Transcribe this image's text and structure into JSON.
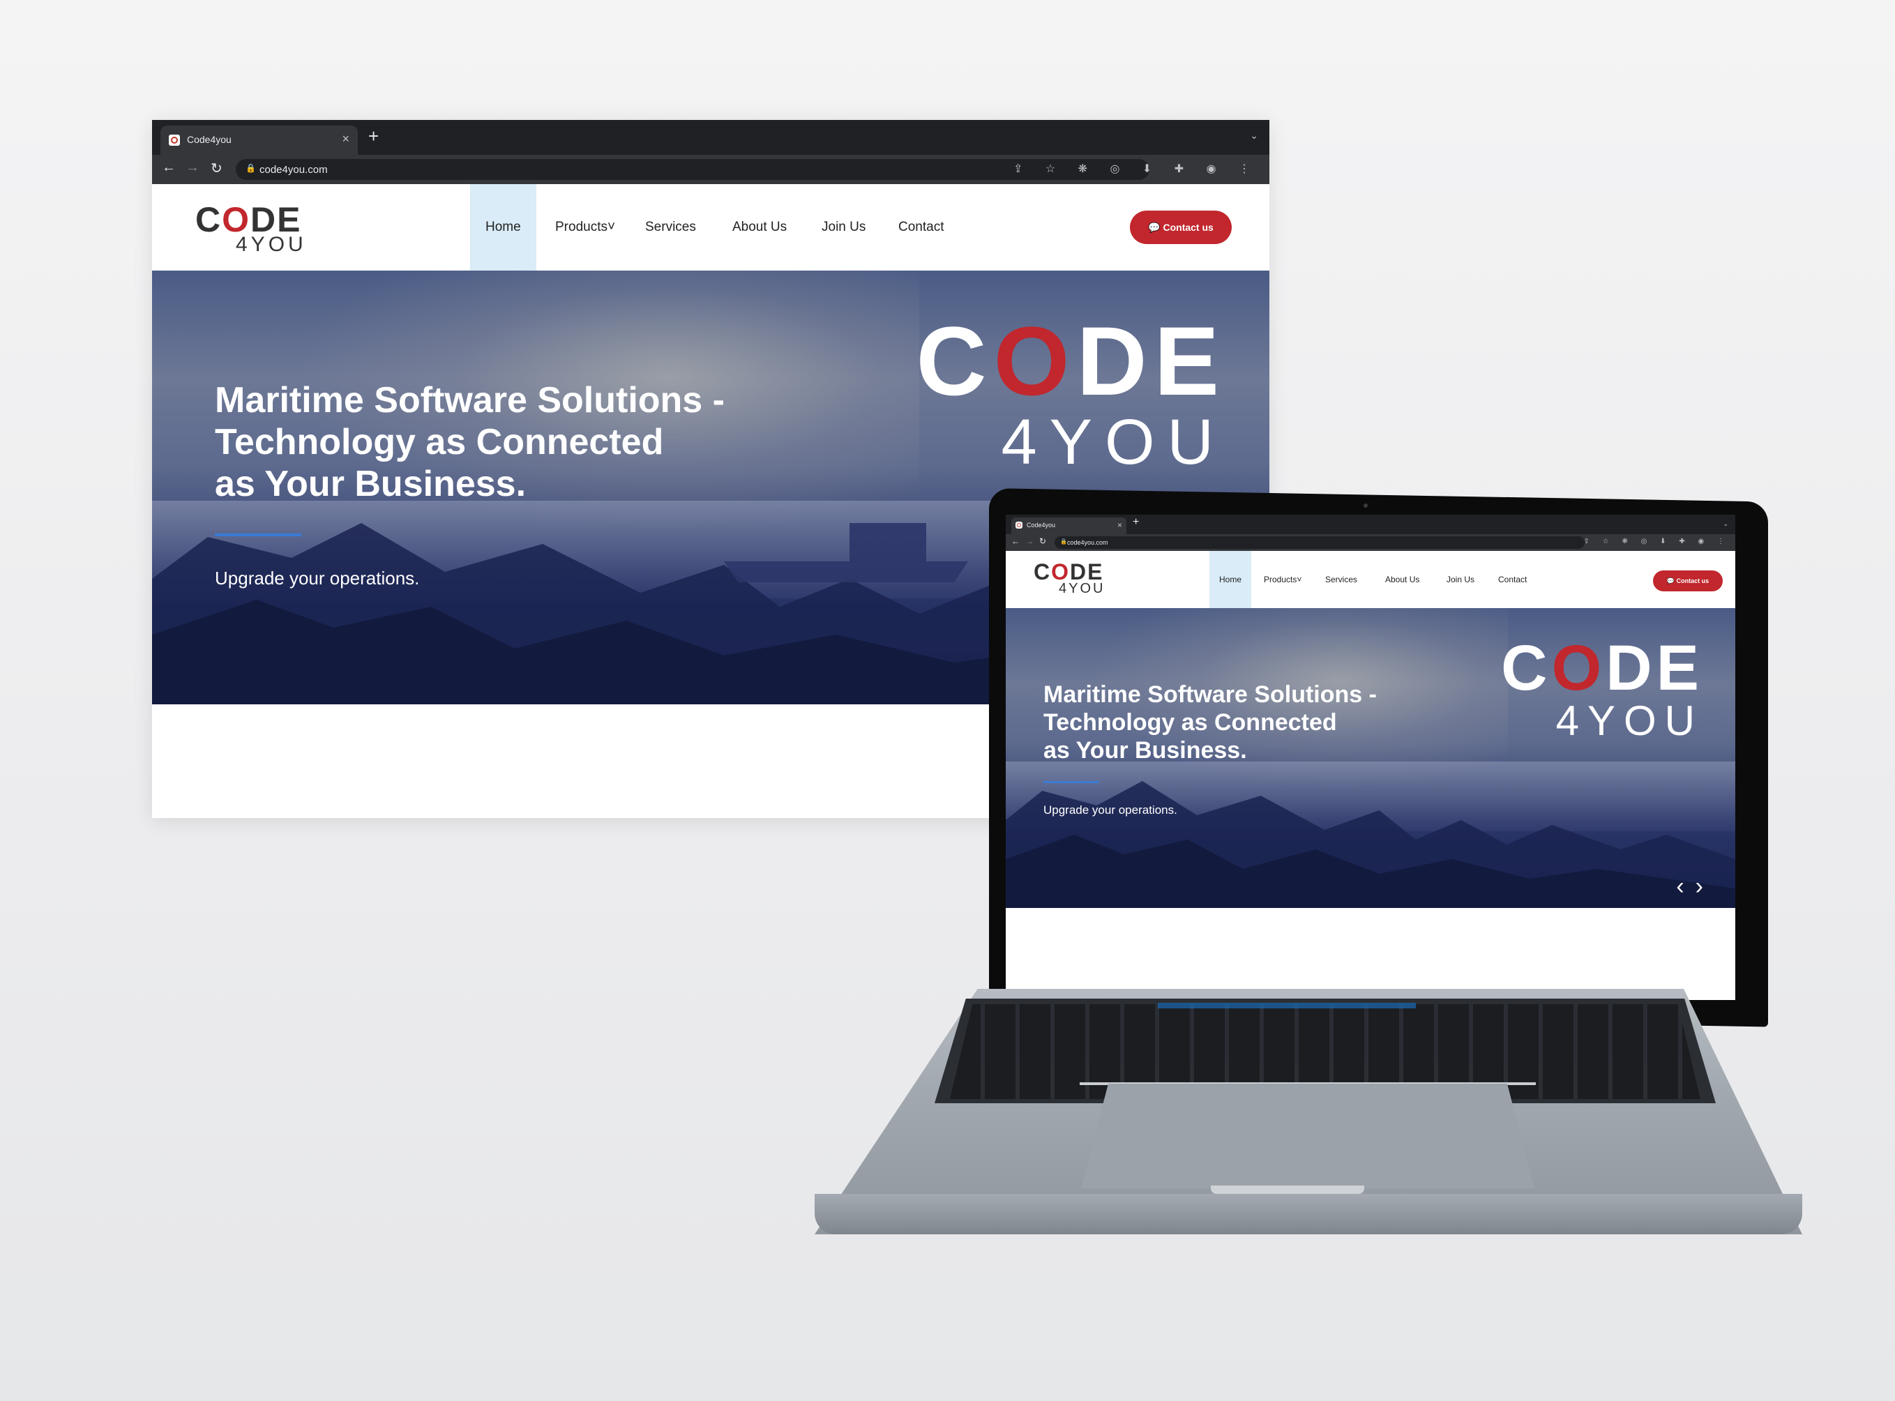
{
  "browser": {
    "tab_title": "Code4you",
    "url": "code4you.com",
    "new_tab": "+",
    "close": "×",
    "tab_menu": "⌄",
    "back": "←",
    "forward": "→",
    "reload": "↻",
    "toolbar_icons": "⇪ ☆ ❋ ◎ ⬇ ✚ ◉ ⋮"
  },
  "site": {
    "logo_top_pre": "C",
    "logo_top_o": "O",
    "logo_top_post": "DE",
    "logo_bottom": "4YOU",
    "nav": {
      "home": "Home",
      "products": "Products",
      "products_caret": "˅",
      "services": "Services",
      "about": "About Us",
      "join": "Join Us",
      "contact": "Contact"
    },
    "contact_button": "💬 Contact us",
    "hero": {
      "line1": "Maritime Software Solutions -",
      "line2": "Technology as Connected",
      "line3": "as Your Business.",
      "subtitle": "Upgrade your operations."
    },
    "carousel": {
      "prev": "‹",
      "next": "›"
    }
  },
  "colors": {
    "brand_red": "#c1272d",
    "accent_blue": "#3a7bd5",
    "nav_active": "#d9ecf7"
  }
}
